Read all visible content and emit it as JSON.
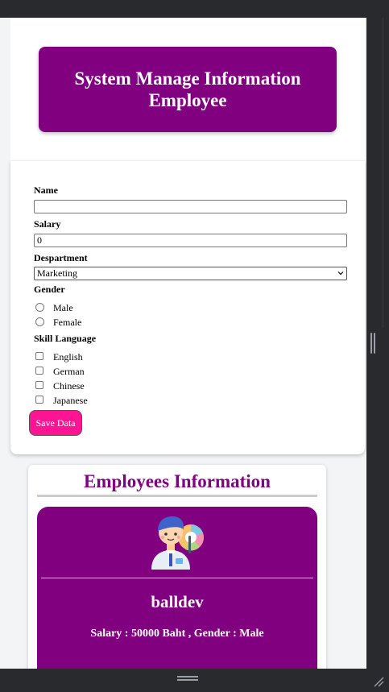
{
  "header": {
    "title": "System Manage Information Employee"
  },
  "form": {
    "name_label": "Name",
    "name_value": "",
    "salary_label": "Salary",
    "salary_value": "0",
    "department_label": "Despartment",
    "department_selected": "Marketing",
    "gender_label": "Gender",
    "gender_options": [
      "Male",
      "Female"
    ],
    "skill_label": "Skill Language",
    "skill_options": [
      "English",
      "German",
      "Chinese",
      "Japanese"
    ],
    "save_label": "Save Data"
  },
  "employees": {
    "section_title": "Employees Information",
    "items": [
      {
        "name": "balldev",
        "detail": "Salary : 50000 Baht , Gender : Male"
      }
    ]
  },
  "colors": {
    "brand": "#800080",
    "save_button": "#ff1493"
  },
  "icons": [
    "chevron-down-icon",
    "employee-avatar-icon",
    "resize-handle-icon",
    "scroll-grip-icon"
  ]
}
